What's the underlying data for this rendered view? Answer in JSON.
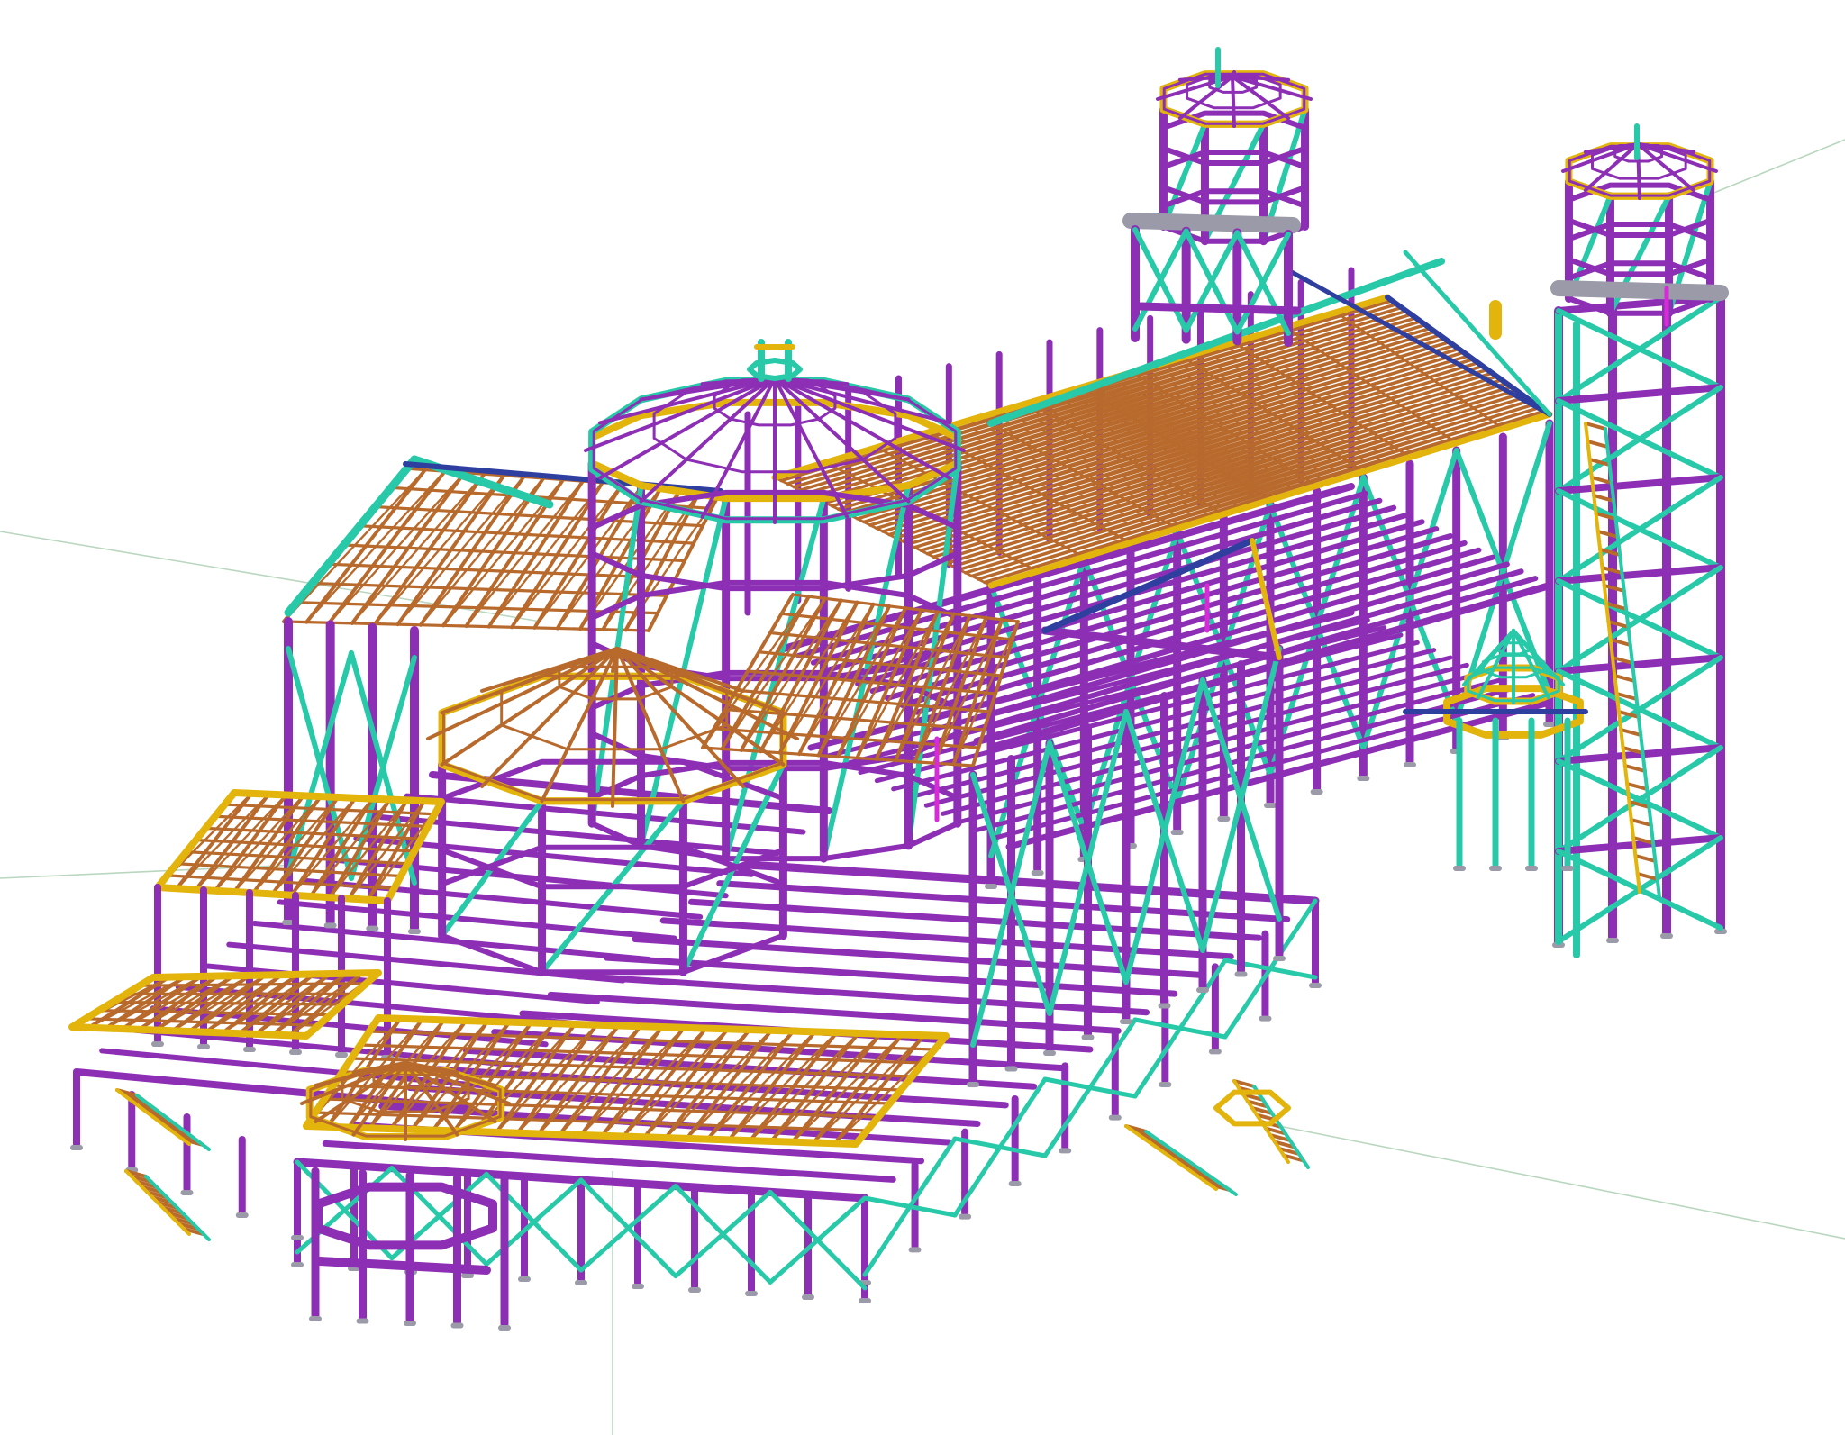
{
  "colors": {
    "background": "#ffffff",
    "column_steel": "#8d2fb5",
    "bracing": "#27c9a8",
    "timber_rafters": "#b86a2c",
    "edge_beams": "#e2b40c",
    "secondary_beams": "#2e3fa0",
    "base_plates": "#9a9aa8",
    "accent_magenta": "#d82bd8",
    "grid_reference": "#b9d7bf"
  },
  "model_parts": [
    "main-roof",
    "dome-tower",
    "left-wing-roof",
    "front-octagon-bay",
    "left-tower",
    "right-tower",
    "lower-left-terrace",
    "front-terrace",
    "right-stair-tower",
    "small-rotunda"
  ]
}
